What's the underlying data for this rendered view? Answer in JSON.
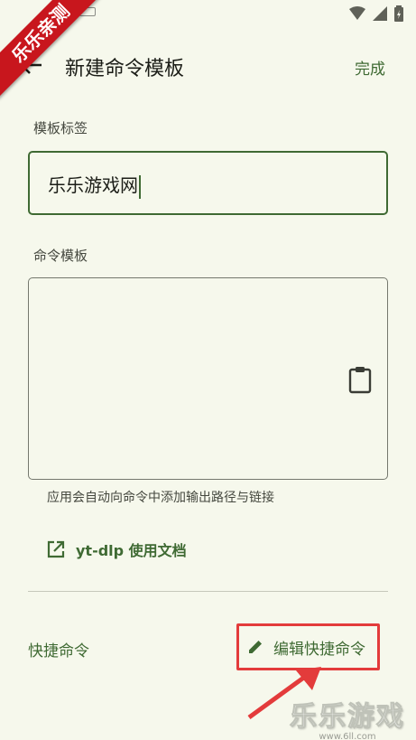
{
  "ribbon": {
    "text": "乐乐亲测"
  },
  "app_bar": {
    "title": "新建命令模板",
    "done_label": "完成"
  },
  "tag_field": {
    "label": "模板标签",
    "value": "乐乐游戏网"
  },
  "template_field": {
    "label": "命令模板",
    "value": "",
    "helper": "应用会自动向命令中添加输出路径与链接"
  },
  "docs_link": {
    "label": "yt-dlp 使用文档"
  },
  "shortcuts": {
    "label": "快捷命令",
    "edit_label": "编辑快捷命令"
  },
  "watermark": {
    "main": "乐乐游戏",
    "url": "www.6ll.com"
  },
  "colors": {
    "background": "#f6f8ec",
    "accent": "#3f6a33",
    "highlight": "#e33b3b",
    "ribbon": "#c8161d"
  },
  "icons": [
    "back-arrow-icon",
    "clipboard-icon",
    "open-in-new-icon",
    "pencil-icon",
    "wifi-icon",
    "signal-icon",
    "battery-icon",
    "keyboard-icon"
  ]
}
